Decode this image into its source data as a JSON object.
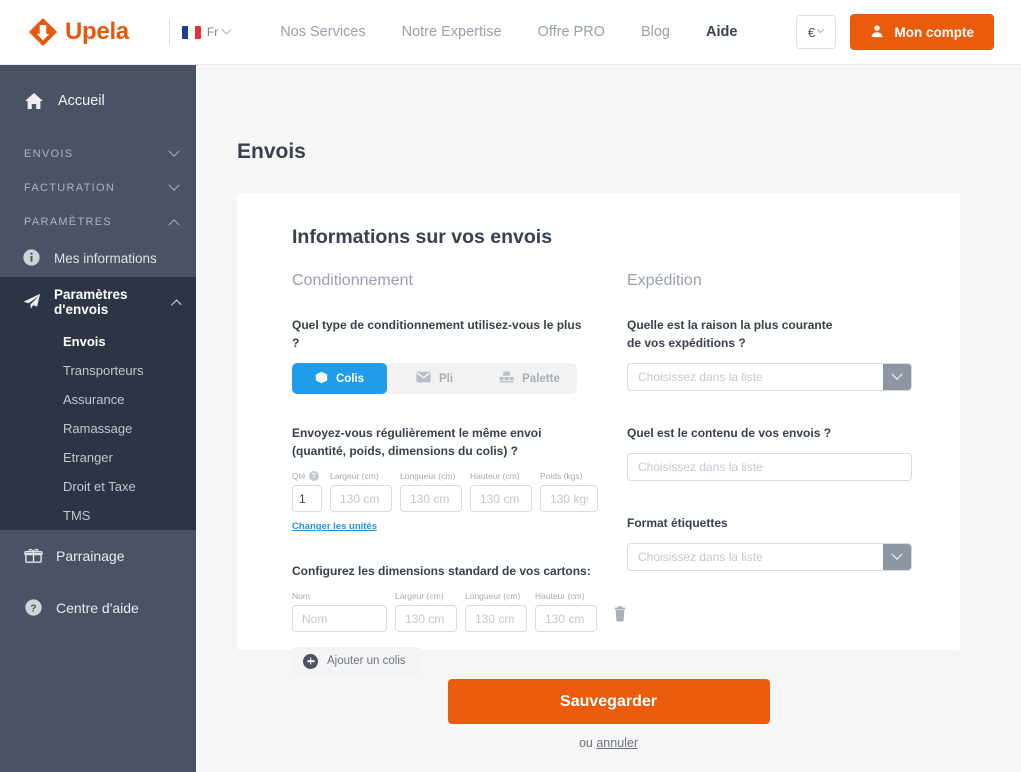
{
  "header": {
    "brand": "Upela",
    "brand_color": "#e8580c",
    "language": "Fr",
    "nav": [
      {
        "label": "Nos Services",
        "active": false
      },
      {
        "label": "Notre Expertise",
        "active": false
      },
      {
        "label": "Offre PRO",
        "active": false
      },
      {
        "label": "Blog",
        "active": false
      },
      {
        "label": "Aide",
        "active": true
      }
    ],
    "currency": "€",
    "account_label": "Mon compte",
    "account_color": "#ea5b0c"
  },
  "sidebar": {
    "bg_color": "#4b5263",
    "active_bg_color": "#2d3444",
    "home": "Accueil",
    "groups": [
      {
        "label": "ENVOIS",
        "expanded": false
      },
      {
        "label": "FACTURATION",
        "expanded": false
      },
      {
        "label": "PARAMÈTRES",
        "expanded": true
      }
    ],
    "mes_informations": "Mes informations",
    "parametres_envois": "Paramètres d'envois",
    "sub_items": [
      {
        "label": "Envois",
        "active": true
      },
      {
        "label": "Transporteurs",
        "active": false
      },
      {
        "label": "Assurance",
        "active": false
      },
      {
        "label": "Ramassage",
        "active": false
      },
      {
        "label": "Etranger",
        "active": false
      },
      {
        "label": "Droit et Taxe",
        "active": false
      },
      {
        "label": "TMS",
        "active": false
      }
    ],
    "parrainage": "Parrainage",
    "centre_aide": "Centre d'aide"
  },
  "main": {
    "page_title": "Envois",
    "card_title": "Informations sur vos envois",
    "conditionnement": {
      "heading": "Conditionnement",
      "question_type": "Quel type de conditionnement utilisez-vous le plus ?",
      "tabs": [
        {
          "label": "Colis",
          "icon": "box-icon",
          "active": true
        },
        {
          "label": "Pli",
          "icon": "envelope-icon",
          "active": false
        },
        {
          "label": "Palette",
          "icon": "pallet-icon",
          "active": false
        }
      ],
      "active_tab_color": "#1f9cea",
      "question_regular_line1": "Envoyez-vous régulièrement le même envoi",
      "question_regular_line2": "(quantité, poids, dimensions du colis) ?",
      "dims": [
        {
          "label": "Qté",
          "help": true,
          "value": "1",
          "placeholder": "1",
          "width": "qte"
        },
        {
          "label": "Largeur (cm)",
          "help": false,
          "value": "",
          "placeholder": "130 cm",
          "width": "dim"
        },
        {
          "label": "Longueur (cm)",
          "help": false,
          "value": "",
          "placeholder": "130 cm",
          "width": "dim"
        },
        {
          "label": "Hauteur (cm)",
          "help": false,
          "value": "",
          "placeholder": "130 cm",
          "width": "dim"
        },
        {
          "label": "Poids (kgs)",
          "help": false,
          "value": "",
          "placeholder": "130 kgs",
          "width": "poids"
        }
      ],
      "change_units_link": "Changer les unités",
      "question_cartons": "Configurez les dimensions standard de vos cartons:",
      "carton_fields": [
        {
          "label": "Nom",
          "placeholder": "Nom",
          "width": "nom"
        },
        {
          "label": "Largeur (cm)",
          "placeholder": "130 cm",
          "width": "dim"
        },
        {
          "label": "Longueur (cm)",
          "placeholder": "130 cm",
          "width": "dim"
        },
        {
          "label": "Hauteur (cm)",
          "placeholder": "130 cm",
          "width": "dim"
        }
      ],
      "add_button": "Ajouter un colis"
    },
    "expedition": {
      "heading": "Expédition",
      "question_raison_line1": "Quelle est la raison la plus courante",
      "question_raison_line2": "de vos expéditions ?",
      "raison_placeholder": "Choisissez dans la liste",
      "question_contenu": "Quel est le contenu de vos envois ?",
      "contenu_placeholder": "Choisissez dans la liste",
      "label_format": "Format étiquettes",
      "format_placeholder": "Choisissez dans la liste"
    },
    "save_button": "Sauvegarder",
    "cancel_prefix": "ou ",
    "cancel_link": "annuler"
  }
}
